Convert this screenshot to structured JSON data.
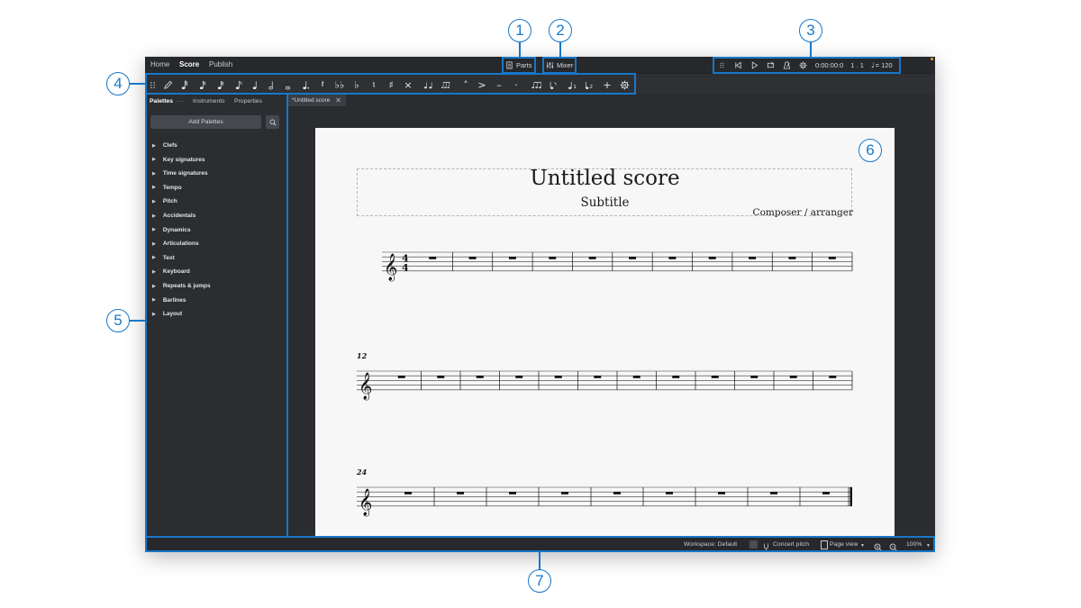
{
  "workspace_tabs": [
    "Home",
    "Score",
    "Publish"
  ],
  "active_tab": "Score",
  "parts_label": "Parts",
  "mixer_label": "Mixer",
  "playback": {
    "time": "0:00:00:0",
    "position": "1 . 1",
    "tempo": "= 120"
  },
  "panel_tabs": [
    "Palettes",
    "Instruments",
    "Properties"
  ],
  "panel_menu": "···",
  "add_palettes_label": "Add Palettes",
  "palettes": [
    "Clefs",
    "Key signatures",
    "Time signatures",
    "Tempo",
    "Pitch",
    "Accidentals",
    "Dynamics",
    "Articulations",
    "Text",
    "Keyboard",
    "Repeats & jumps",
    "Barlines",
    "Layout"
  ],
  "score_tab": {
    "label": "*Untitled score",
    "close": "✕"
  },
  "score": {
    "title": "Untitled score",
    "subtitle": "Subtitle",
    "composer": "Composer / arranger",
    "time_signature": [
      "4",
      "4"
    ],
    "systems": [
      {
        "measure_number": "",
        "measures": 11
      },
      {
        "measure_number": "12",
        "measures": 12
      },
      {
        "measure_number": "24",
        "measures": 9
      }
    ]
  },
  "status": {
    "workspace": "Workspace: Default",
    "concert_pitch": "Concert pitch",
    "view_mode": "Page view",
    "zoom": "100%"
  },
  "callouts": [
    "1",
    "2",
    "3",
    "4",
    "5",
    "6",
    "7"
  ],
  "colors": {
    "accent": "#1877c9",
    "window_bg": "#2b2d31",
    "paper": "#f7f7f7"
  }
}
